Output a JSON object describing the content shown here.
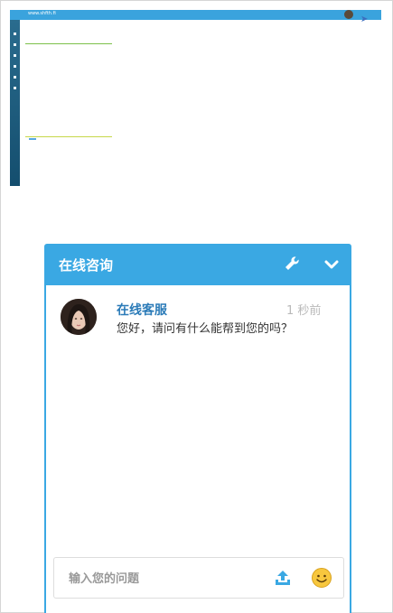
{
  "thumbnail": {
    "title": "www.shfth.fi",
    "panel_a_title": "",
    "panel_b_title": "",
    "colors": {
      "topbar": "#3aa3dd",
      "sidebar": "#1c5a7a"
    }
  },
  "chat": {
    "title": "在线咨询",
    "header_color": "#3aa8e3",
    "icons": {
      "tool": "wrench-icon",
      "collapse": "chevron-down-icon"
    },
    "messages": [
      {
        "sender": "在线客服",
        "time": "1 秒前",
        "text": "您好，请问有什么能帮到您的吗？"
      }
    ],
    "input": {
      "placeholder": "输入您的问题",
      "value": ""
    },
    "actions": {
      "upload": "upload-icon",
      "emoji": "smiley-icon"
    }
  }
}
